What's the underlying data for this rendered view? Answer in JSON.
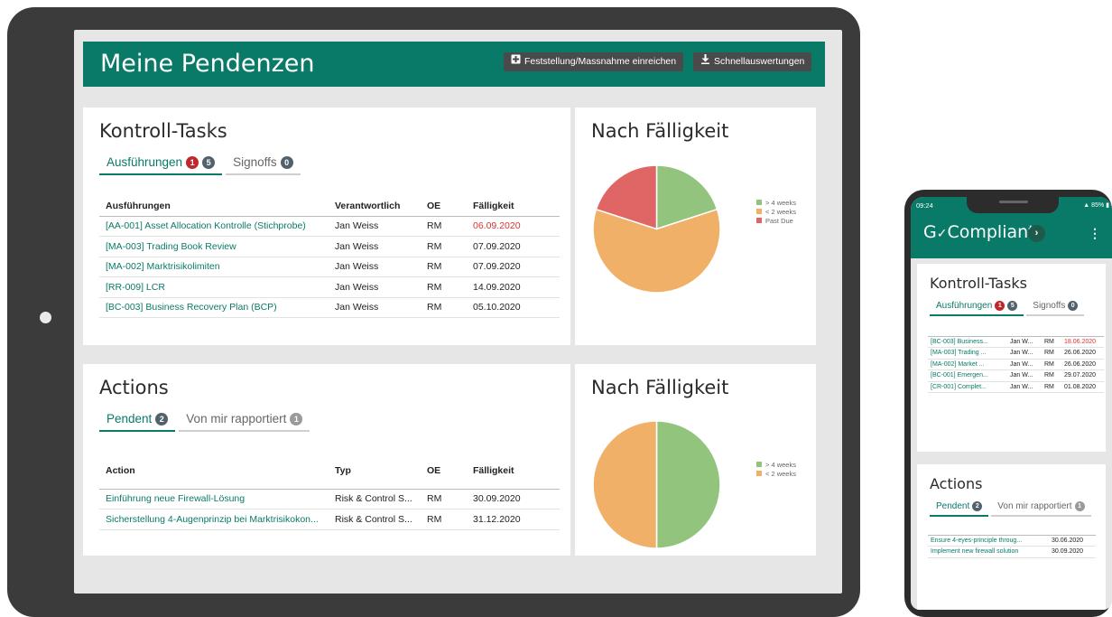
{
  "tablet": {
    "header": {
      "title": "Meine Pendenzen",
      "submit_button": "Feststellung/Massnahme einreichen",
      "reports_button": "Schnellauswertungen"
    },
    "control_tasks": {
      "title": "Kontroll-Tasks",
      "tabs": [
        {
          "label": "Ausführungen",
          "badges": [
            "1",
            "5"
          ],
          "active": true
        },
        {
          "label": "Signoffs",
          "badges": [
            "0"
          ],
          "active": false
        }
      ],
      "columns": [
        "Ausführungen",
        "Verantwortlich",
        "OE",
        "Fälligkeit"
      ],
      "rows": [
        {
          "task": "[AA-001] Asset Allocation Kontrolle (Stichprobe)",
          "owner": "Jan Weiss",
          "oe": "RM",
          "due": "06.09.2020",
          "overdue": true
        },
        {
          "task": "[MA-003] Trading Book Review",
          "owner": "Jan Weiss",
          "oe": "RM",
          "due": "07.09.2020",
          "overdue": false
        },
        {
          "task": "[MA-002] Marktrisikolimiten",
          "owner": "Jan Weiss",
          "oe": "RM",
          "due": "07.09.2020",
          "overdue": false
        },
        {
          "task": "[RR-009] LCR",
          "owner": "Jan Weiss",
          "oe": "RM",
          "due": "14.09.2020",
          "overdue": false
        },
        {
          "task": "[BC-003] Business Recovery Plan (BCP)",
          "owner": "Jan Weiss",
          "oe": "RM",
          "due": "05.10.2020",
          "overdue": false
        }
      ]
    },
    "tasks_chart": {
      "title": "Nach Fälligkeit",
      "legend": [
        "> 4 weeks",
        "< 2 weeks",
        "Past Due"
      ]
    },
    "actions": {
      "title": "Actions",
      "tabs": [
        {
          "label": "Pendent",
          "badges": [
            "2"
          ],
          "active": true
        },
        {
          "label": "Von mir rapportiert",
          "badges": [
            "1"
          ],
          "active": false
        }
      ],
      "columns": [
        "Action",
        "Typ",
        "OE",
        "Fälligkeit"
      ],
      "rows": [
        {
          "action": "Einführung neue Firewall-Lösung",
          "type": "Risk & Control S...",
          "oe": "RM",
          "due": "30.09.2020"
        },
        {
          "action": "Sicherstellung 4-Augenprinzip bei Marktrisikokon...",
          "type": "Risk & Control S...",
          "oe": "RM",
          "due": "31.12.2020"
        }
      ]
    },
    "actions_chart": {
      "title": "Nach Fälligkeit",
      "legend": [
        "> 4 weeks",
        "< 2 weeks"
      ]
    }
  },
  "phone": {
    "status_time": "09:24",
    "status_right": "85%",
    "brand_pre": "G",
    "brand_post": "Compliant",
    "control_tasks": {
      "title": "Kontroll-Tasks",
      "tabs": [
        {
          "label": "Ausführungen",
          "badges": [
            "1",
            "5"
          ],
          "active": true
        },
        {
          "label": "Signoffs",
          "badges": [
            "0"
          ],
          "active": false
        }
      ],
      "rows": [
        {
          "task": "[BC-003] Business...",
          "owner": "Jan W...",
          "oe": "RM",
          "due": "18.06.2020",
          "overdue": true
        },
        {
          "task": "[MA-003] Trading ...",
          "owner": "Jan W...",
          "oe": "RM",
          "due": "26.06.2020",
          "overdue": false
        },
        {
          "task": "[MA-002] Market ...",
          "owner": "Jan W...",
          "oe": "RM",
          "due": "26.06.2020",
          "overdue": false
        },
        {
          "task": "[BC-001] Emergen...",
          "owner": "Jan W...",
          "oe": "RM",
          "due": "29.07.2020",
          "overdue": false
        },
        {
          "task": "[CR-001] Complet...",
          "owner": "Jan W...",
          "oe": "RM",
          "due": "01.08.2020",
          "overdue": false
        }
      ]
    },
    "actions": {
      "title": "Actions",
      "tabs": [
        {
          "label": "Pendent",
          "badges": [
            "2"
          ],
          "active": true
        },
        {
          "label": "Von mir rapportiert",
          "badges": [
            "1"
          ],
          "active": false
        }
      ],
      "rows": [
        {
          "action": "Ensure 4-eyes-principle throug...",
          "due": "30.06.2020"
        },
        {
          "action": "Implement new firewall solution",
          "due": "30.09.2020"
        }
      ]
    }
  },
  "colors": {
    "brand": "#0a7a68",
    "over4weeks": "#93c47d",
    "under2weeks": "#f0b067",
    "pastdue": "#e06666",
    "overdue_text": "#dd3333"
  },
  "chart_data": [
    {
      "type": "pie",
      "title": "Nach Fälligkeit",
      "categories": [
        "> 4 weeks",
        "< 2 weeks",
        "Past Due"
      ],
      "values": [
        1,
        3,
        1
      ],
      "legend": "right"
    },
    {
      "type": "pie",
      "title": "Nach Fälligkeit",
      "categories": [
        "> 4 weeks",
        "< 2 weeks"
      ],
      "values": [
        1,
        1
      ],
      "legend": "right"
    }
  ]
}
